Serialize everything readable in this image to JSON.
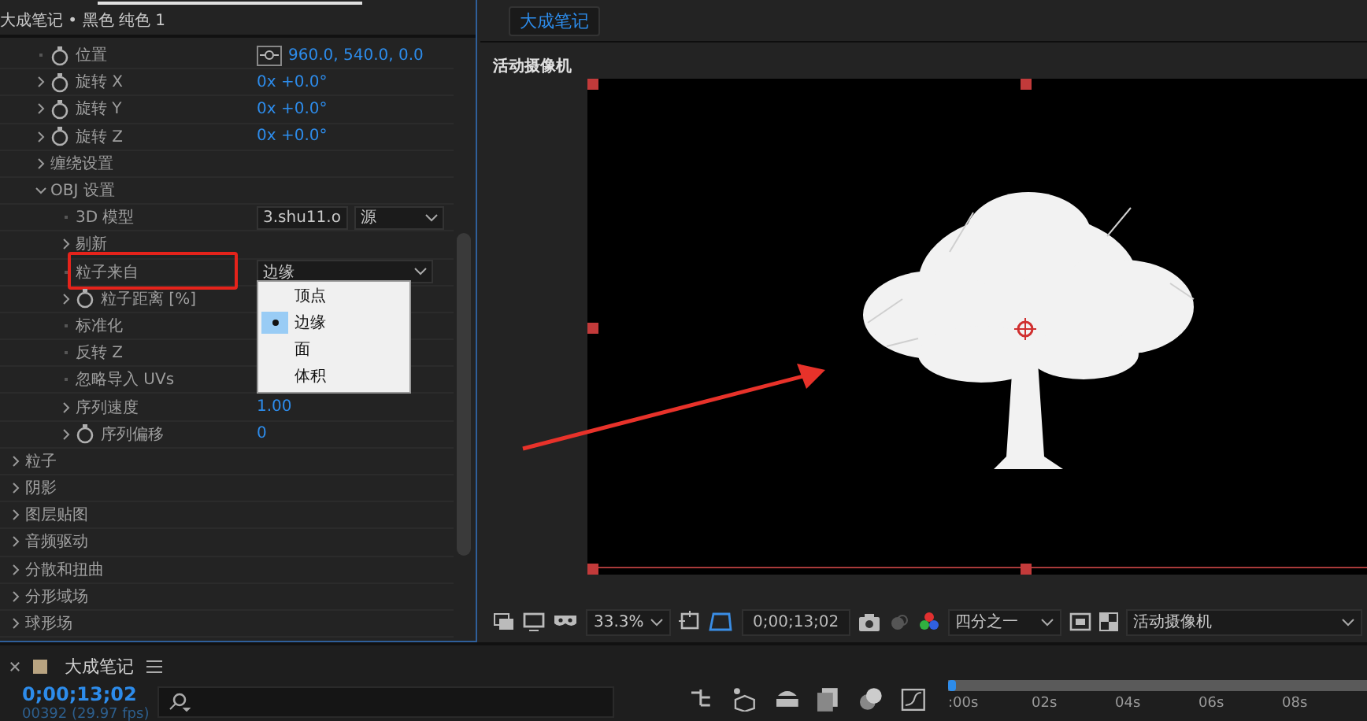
{
  "effect_panel": {
    "header": "大成笔记 • 黑色 纯色 1",
    "rows": [
      {
        "kind": "leaf",
        "label": "位置",
        "stopwatch": true,
        "value": {
          "kind": "point",
          "text": "960.0, 540.0, 0.0"
        }
      },
      {
        "kind": "group",
        "label": "旋转 X",
        "stopwatch": true,
        "expanded": false,
        "value": {
          "kind": "number",
          "text": "0x +0.0°"
        }
      },
      {
        "kind": "group",
        "label": "旋转 Y",
        "stopwatch": true,
        "expanded": false,
        "value": {
          "kind": "number",
          "text": "0x +0.0°"
        }
      },
      {
        "kind": "group",
        "label": "旋转 Z",
        "stopwatch": true,
        "expanded": false,
        "value": {
          "kind": "number",
          "text": "0x +0.0°"
        }
      },
      {
        "kind": "group",
        "label": "缠绕设置",
        "expanded": false
      },
      {
        "kind": "group",
        "label": "OBJ 设置",
        "expanded": true,
        "children": [
          {
            "kind": "leaf",
            "label": "3D 模型",
            "value": {
              "kind": "dropdowns",
              "options": [
                "3.shu11.o",
                "源"
              ]
            }
          },
          {
            "kind": "group",
            "label": "剔新",
            "expanded": false
          },
          {
            "kind": "leaf",
            "label": "粒子来自",
            "highlighted": true,
            "value": {
              "kind": "dropdown",
              "text": "边缘",
              "open": true,
              "menu": [
                {
                  "label": "顶点",
                  "selected": false
                },
                {
                  "label": "边缘",
                  "selected": true
                },
                {
                  "label": "面",
                  "selected": false
                },
                {
                  "label": "体积",
                  "selected": false
                }
              ]
            }
          },
          {
            "kind": "group",
            "label": "粒子距离 [%]",
            "stopwatch": true,
            "expanded": false
          },
          {
            "kind": "leaf",
            "label": "标准化"
          },
          {
            "kind": "leaf",
            "label": "反转 Z"
          },
          {
            "kind": "leaf",
            "label": "忽略导入 UVs"
          },
          {
            "kind": "group",
            "label": "序列速度",
            "expanded": false,
            "value": {
              "kind": "number",
              "text": "1.00"
            }
          },
          {
            "kind": "group",
            "label": "序列偏移",
            "stopwatch": true,
            "expanded": false,
            "value": {
              "kind": "number",
              "text": "0"
            }
          }
        ]
      }
    ],
    "groups": [
      {
        "label": "粒子",
        "expanded": false
      },
      {
        "label": "阴影",
        "expanded": false
      },
      {
        "label": "图层贴图",
        "expanded": false
      },
      {
        "label": "音频驱动",
        "expanded": false
      },
      {
        "label": "分散和扭曲",
        "expanded": false
      },
      {
        "label": "分形域场",
        "expanded": false
      },
      {
        "label": "球形场",
        "expanded": false
      }
    ]
  },
  "viewer": {
    "tab": "大成笔记",
    "camera_label": "活动摄像机"
  },
  "viewer_toolbar": {
    "zoom": "33.3%",
    "timecode": "0;00;13;02",
    "resolution": "四分之一",
    "camera": "活动摄像机"
  },
  "timeline": {
    "title": "大成笔记",
    "timecode": "0;00;13;02",
    "frame_info": "00392 (29.97 fps)",
    "ruler": [
      ":00s",
      "02s",
      "04s",
      "06s",
      "08s"
    ]
  }
}
